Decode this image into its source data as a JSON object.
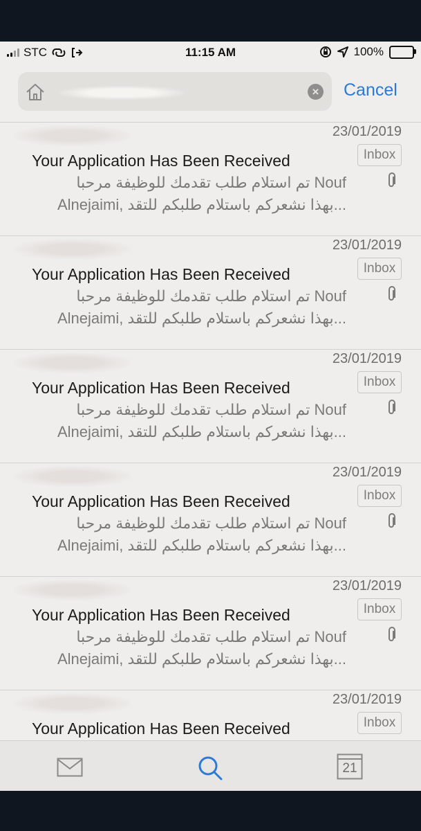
{
  "status_bar": {
    "carrier": "STC",
    "time": "11:15 AM",
    "battery": "100%"
  },
  "search": {
    "placeholder": "",
    "cancel_label": "Cancel"
  },
  "emails": [
    {
      "date": "23/01/2019",
      "subject": "Your Application Has Been Received",
      "folder": "Inbox",
      "preview_line1": "تم استلام طلب تقدمك للوظيفة مرحبا Nouf",
      "preview_line2": "Alnejaimi, بهذا نشعركم باستلام طلبكم للتقد...",
      "has_attachment": true
    },
    {
      "date": "23/01/2019",
      "subject": "Your Application Has Been Received",
      "folder": "Inbox",
      "preview_line1": "تم استلام طلب تقدمك للوظيفة مرحبا Nouf",
      "preview_line2": "Alnejaimi, بهذا نشعركم باستلام طلبكم للتقد...",
      "has_attachment": true
    },
    {
      "date": "23/01/2019",
      "subject": "Your Application Has Been Received",
      "folder": "Inbox",
      "preview_line1": "تم استلام طلب تقدمك للوظيفة مرحبا Nouf",
      "preview_line2": "Alnejaimi, بهذا نشعركم باستلام طلبكم للتقد...",
      "has_attachment": true
    },
    {
      "date": "23/01/2019",
      "subject": "Your Application Has Been Received",
      "folder": "Inbox",
      "preview_line1": "تم استلام طلب تقدمك للوظيفة مرحبا Nouf",
      "preview_line2": "Alnejaimi, بهذا نشعركم باستلام طلبكم للتقد...",
      "has_attachment": true
    },
    {
      "date": "23/01/2019",
      "subject": "Your Application Has Been Received",
      "folder": "Inbox",
      "preview_line1": "تم استلام طلب تقدمك للوظيفة مرحبا Nouf",
      "preview_line2": "Alnejaimi, بهذا نشعركم باستلام طلبكم للتقد...",
      "has_attachment": true
    },
    {
      "date": "23/01/2019",
      "subject": "Your Application Has Been Received",
      "folder": "Inbox",
      "preview_line1": "",
      "preview_line2": "",
      "has_attachment": false
    }
  ],
  "tab_bar": {
    "mail_icon": "envelope-icon",
    "search_icon": "search-icon",
    "calendar_day": "21"
  },
  "colors": {
    "accent": "#2d7ad6",
    "background": "#efeeec"
  }
}
